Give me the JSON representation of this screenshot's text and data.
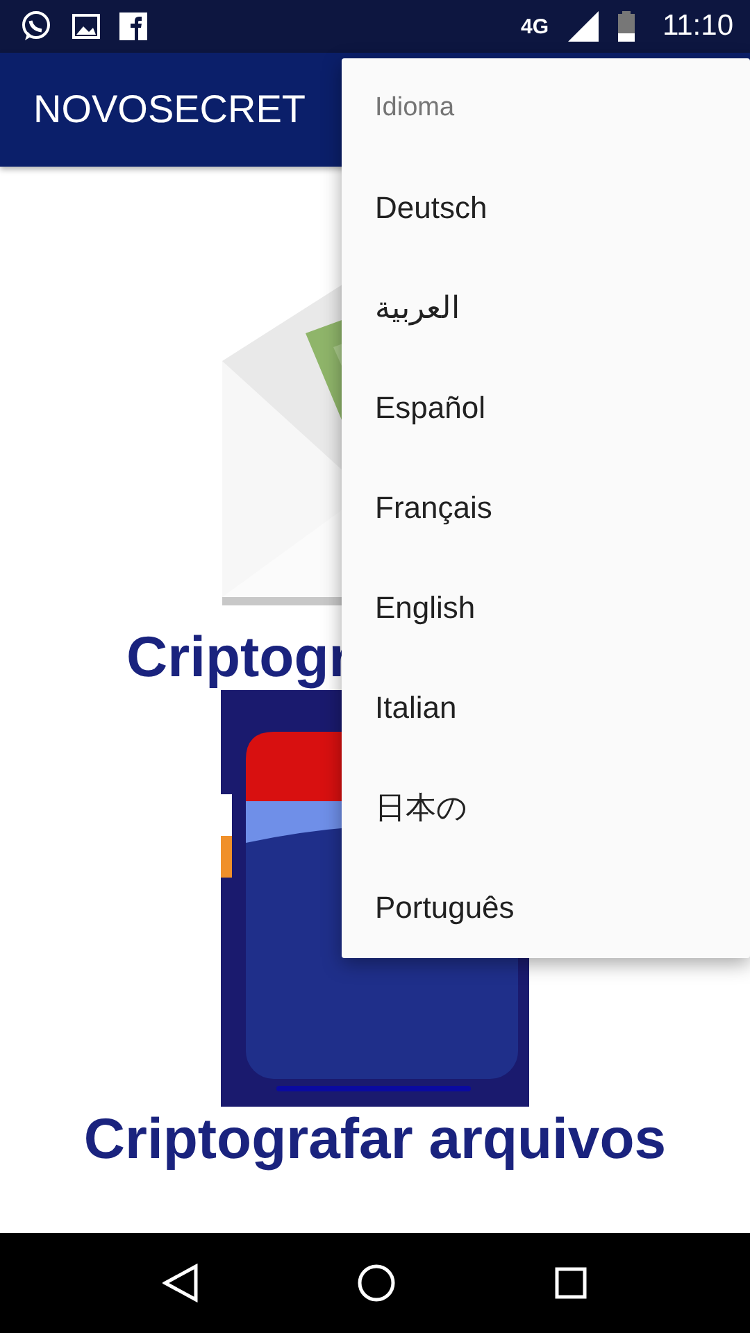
{
  "status_bar": {
    "time": "11:10",
    "network": "4G"
  },
  "app_bar": {
    "title": "NOVOSECRET"
  },
  "content": [
    {
      "kind": "picture",
      "caption": "Criptogr"
    },
    {
      "kind": "picture",
      "caption": "Criptografar arquivos"
    }
  ],
  "menu": {
    "header": "Idioma",
    "items": [
      {
        "label": "Deutsch"
      },
      {
        "label": "العربية"
      },
      {
        "label": "Español"
      },
      {
        "label": "Français"
      },
      {
        "label": "English"
      },
      {
        "label": "Italian"
      },
      {
        "label": "日本の"
      },
      {
        "label": "Português"
      }
    ]
  }
}
